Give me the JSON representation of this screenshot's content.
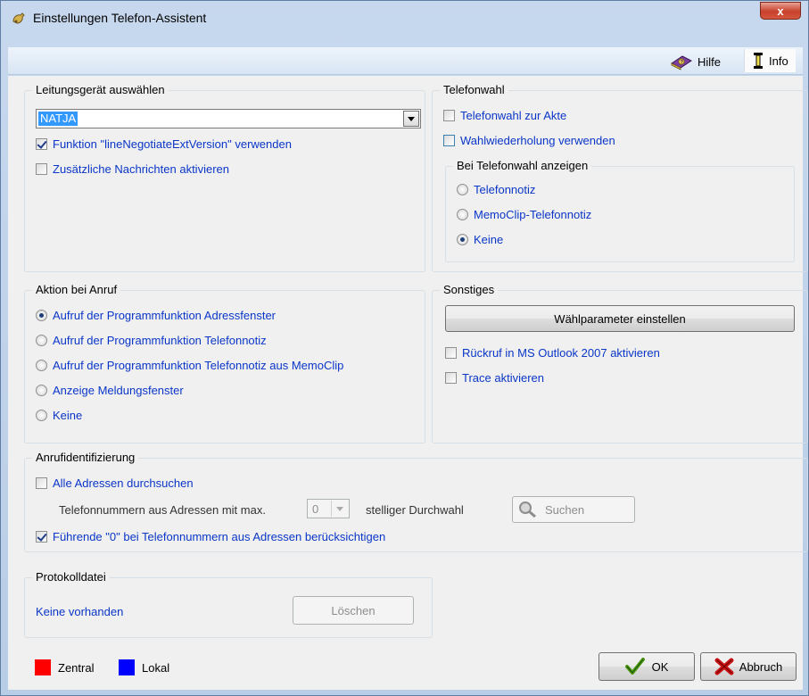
{
  "window": {
    "title": "Einstellungen Telefon-Assistent",
    "close_label": "x"
  },
  "toolbar": {
    "help_label": "Hilfe",
    "info_label": "Info"
  },
  "line_device": {
    "title": "Leitungsgerät auswählen",
    "selected": "NATJA",
    "options": [
      {
        "label": "Funktion \"lineNegotiateExtVersion\" verwenden",
        "checked": true
      },
      {
        "label": "Zusätzliche Nachrichten aktivieren",
        "checked": false
      }
    ]
  },
  "dialing": {
    "title": "Telefonwahl",
    "options": [
      {
        "label": "Telefonwahl zur Akte",
        "checked": false
      },
      {
        "label": "Wahlwiederholung verwenden",
        "checked": false
      }
    ],
    "show_group": {
      "title": "Bei Telefonwahl anzeigen",
      "radios": [
        {
          "label": "Telefonnotiz",
          "checked": false
        },
        {
          "label": "MemoClip-Telefonnotiz",
          "checked": false
        },
        {
          "label": "Keine",
          "checked": true
        }
      ]
    }
  },
  "call_action": {
    "title": "Aktion bei Anruf",
    "radios": [
      {
        "label": "Aufruf der Programmfunktion Adressfenster",
        "checked": true
      },
      {
        "label": "Aufruf der Programmfunktion Telefonnotiz",
        "checked": false
      },
      {
        "label": "Aufruf der Programmfunktion Telefonnotiz aus MemoClip",
        "checked": false
      },
      {
        "label": "Anzeige Meldungsfenster",
        "checked": false
      },
      {
        "label": "Keine",
        "checked": false
      }
    ]
  },
  "misc": {
    "title": "Sonstiges",
    "dial_params_button": "Wählparameter einstellen",
    "options": [
      {
        "label": "Rückruf in MS Outlook 2007 aktivieren",
        "checked": false
      },
      {
        "label": "Trace aktivieren",
        "checked": false
      }
    ]
  },
  "caller_id": {
    "title": "Anrufidentifizierung",
    "search_all": {
      "label": "Alle Adressen durchsuchen",
      "checked": false
    },
    "digits_prefix": "Telefonnummern aus Adressen mit max.",
    "digits_value": "0",
    "digits_suffix": "stelliger Durchwahl",
    "search_button": "Suchen",
    "leading_zero": {
      "label": "Führende \"0\" bei Telefonnummern aus Adressen berücksichtigen",
      "checked": true
    }
  },
  "log_file": {
    "title": "Protokolldatei",
    "status": "Keine vorhanden",
    "delete_button": "Löschen"
  },
  "legend": [
    {
      "label": "Zentral",
      "color": "#ff0000"
    },
    {
      "label": "Lokal",
      "color": "#0000ff"
    }
  ],
  "footer": {
    "ok_label": "OK",
    "cancel_label": "Abbruch"
  }
}
